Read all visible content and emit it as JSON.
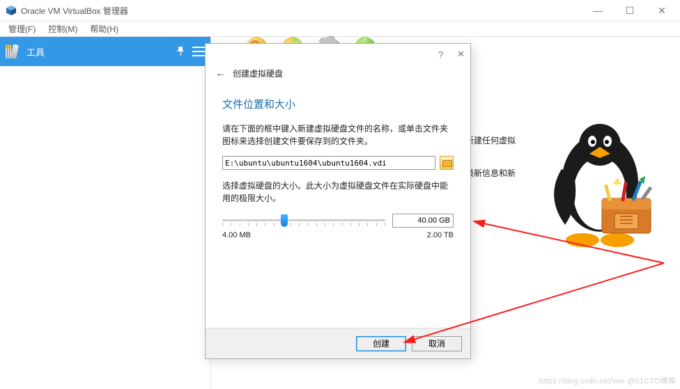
{
  "window": {
    "title": "Oracle VM VirtualBox 管理器"
  },
  "menubar": {
    "file": "管理(F)",
    "machine": "控制(M)",
    "help": "帮助(H)"
  },
  "sidebar": {
    "tool_label": "工具"
  },
  "background": {
    "line1": "新建任何虚拟",
    "line2": "最新信息和新"
  },
  "dialog": {
    "header_title": "创建虚拟硬盘",
    "section_title": "文件位置和大小",
    "desc1": "请在下面的框中键入新建虚拟硬盘文件的名称，或单击文件夹图标来选择创建文件要保存到的文件夹。",
    "path_value": "E:\\ubuntu\\ubuntu1604\\ubuntu1604.vdi",
    "desc2": "选择虚拟硬盘的大小。此大小为虚拟硬盘文件在实际硬盘中能用的极限大小。",
    "size_value": "40.00 GB",
    "min_label": "4.00 MB",
    "max_label": "2.00 TB",
    "create_btn": "创建",
    "cancel_btn": "取消"
  },
  "watermark": "https://blog.csdn.net/wei   @51CTO博客"
}
